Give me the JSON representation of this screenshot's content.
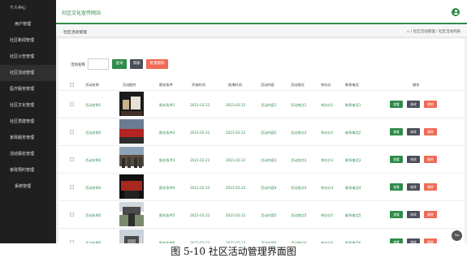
{
  "sidebar": {
    "items": [
      {
        "label": "个人中心"
      },
      {
        "label": "用户管理"
      },
      {
        "label": "社区新闻管理"
      },
      {
        "label": "社区公告管理"
      },
      {
        "label": "社区活动管理"
      },
      {
        "label": "医疗服务管理"
      },
      {
        "label": "社区文化管理"
      },
      {
        "label": "社区党建管理"
      },
      {
        "label": "家政服务管理"
      },
      {
        "label": "活动报名管理"
      },
      {
        "label": "家政预约管理"
      },
      {
        "label": "系统管理"
      }
    ]
  },
  "header": {
    "site_title": "社区文化宣传网站"
  },
  "breadcrumb": {
    "page": "社区活动管理",
    "home_icon": "⌂",
    "path": "/ 社区活动管理 / 社区活动列表"
  },
  "search": {
    "label": "活动名称",
    "value": "",
    "query_button": "查询",
    "add_button": "添加",
    "batch_delete_button": "批量删除"
  },
  "table": {
    "headers": [
      "活动名称",
      "活动图片",
      "报名条件",
      "开始时间",
      "结束时间",
      "活动内容",
      "活动地点",
      "举办方",
      "联系电话",
      "操作"
    ],
    "actions": {
      "view": "查看",
      "edit": "修改",
      "delete": "删除"
    },
    "rows": [
      {
        "name": "活动名称1",
        "condition": "报名条件1",
        "start": "2021-02-22",
        "end": "2021-02-22",
        "content": "活动内容1",
        "place": "活动地点1",
        "host": "举办方1",
        "phone": "联系电话1"
      },
      {
        "name": "活动名称2",
        "condition": "报名条件2",
        "start": "2021-02-22",
        "end": "2021-02-22",
        "content": "活动内容2",
        "place": "活动地点2",
        "host": "举办方2",
        "phone": "联系电话2"
      },
      {
        "name": "活动名称3",
        "condition": "报名条件3",
        "start": "2021-02-22",
        "end": "2021-02-22",
        "content": "活动内容3",
        "place": "活动地点3",
        "host": "举办方3",
        "phone": "联系电话3"
      },
      {
        "name": "活动名称4",
        "condition": "报名条件4",
        "start": "2021-02-22",
        "end": "2021-02-22",
        "content": "活动内容4",
        "place": "活动地点4",
        "host": "举办方4",
        "phone": "联系电话4"
      },
      {
        "name": "活动名称5",
        "condition": "报名条件5",
        "start": "2021-02-22",
        "end": "2021-02-22",
        "content": "活动内容5",
        "place": "活动地点5",
        "host": "举办方5",
        "phone": "联系电话5"
      },
      {
        "name": "活动名称6",
        "condition": "报名条件6",
        "start": "2021-02-22",
        "end": "2021-02-22",
        "content": "活动内容6",
        "place": "活动地点6",
        "host": "举办方6",
        "phone": "联系电话6"
      }
    ]
  },
  "back_to_top": "Top",
  "caption": "图 5-10 社区活动管理界面图",
  "colors": {
    "accent": "#2e8b4a",
    "sidebar": "#1f1f1f",
    "danger": "#f06a55",
    "neutral_button": "#4a4f59"
  }
}
